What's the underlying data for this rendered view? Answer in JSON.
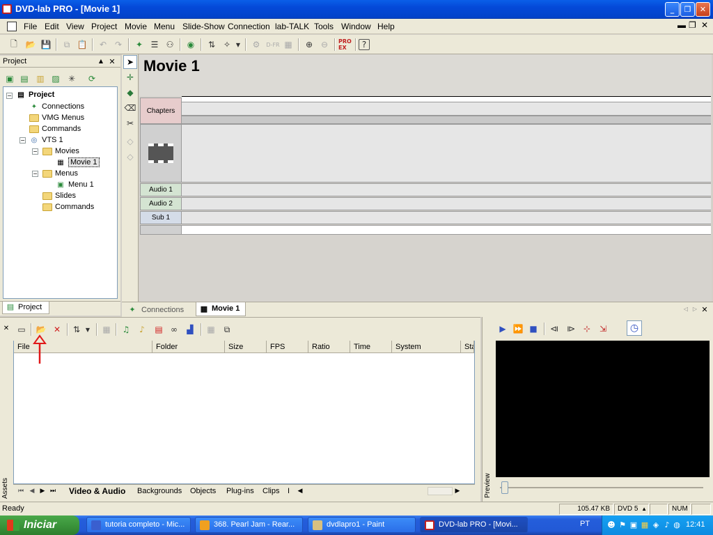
{
  "window": {
    "title": "DVD-lab PRO  - [Movie 1]"
  },
  "menubar": [
    "File",
    "Edit",
    "View",
    "Project",
    "Movie",
    "Menu",
    "Slide-Show",
    "Connection",
    "lab-TALK",
    "Tools",
    "Window",
    "Help"
  ],
  "project_panel": {
    "title": "Project",
    "tree": {
      "root": "Project",
      "connections": "Connections",
      "vmg_menus": "VMG Menus",
      "commands": "Commands",
      "vts": "VTS 1",
      "movies": "Movies",
      "movie1": "Movie 1",
      "menus": "Menus",
      "menu1": "Menu 1",
      "slides": "Slides",
      "commands2": "Commands"
    },
    "tab": "Project"
  },
  "editor": {
    "title": "Movie 1",
    "tracks": {
      "chapters": "Chapters",
      "audio1": "Audio 1",
      "audio2": "Audio 2",
      "sub1": "Sub 1"
    }
  },
  "doc_tabs": {
    "connections": "Connections",
    "movie": "Movie 1"
  },
  "assets": {
    "side_label": "Assets",
    "columns": [
      "File",
      "Folder",
      "Size",
      "FPS",
      "Ratio",
      "Time",
      "System",
      "Sta"
    ],
    "tabs": {
      "video": "Video & Audio",
      "backgrounds": "Backgrounds",
      "objects": "Objects",
      "plugins": "Plug-ins",
      "clips": "Clips",
      "more": "I"
    }
  },
  "preview": {
    "side_label": "Preview"
  },
  "status": {
    "ready": "Ready",
    "size": "105.47 KB",
    "disc": "DVD 5",
    "num": "NUM"
  },
  "taskbar": {
    "start": "Iniciar",
    "tasks": [
      "tutoria completo - Mic...",
      "368. Pearl Jam - Rear...",
      "dvdlapro1 - Paint",
      "DVD-lab PRO - [Movi..."
    ],
    "lang": "PT",
    "clock": "12:41"
  },
  "colors": {
    "xp_blue": "#0449d8",
    "face": "#ece9d8",
    "annotation_red": "#e01818"
  }
}
